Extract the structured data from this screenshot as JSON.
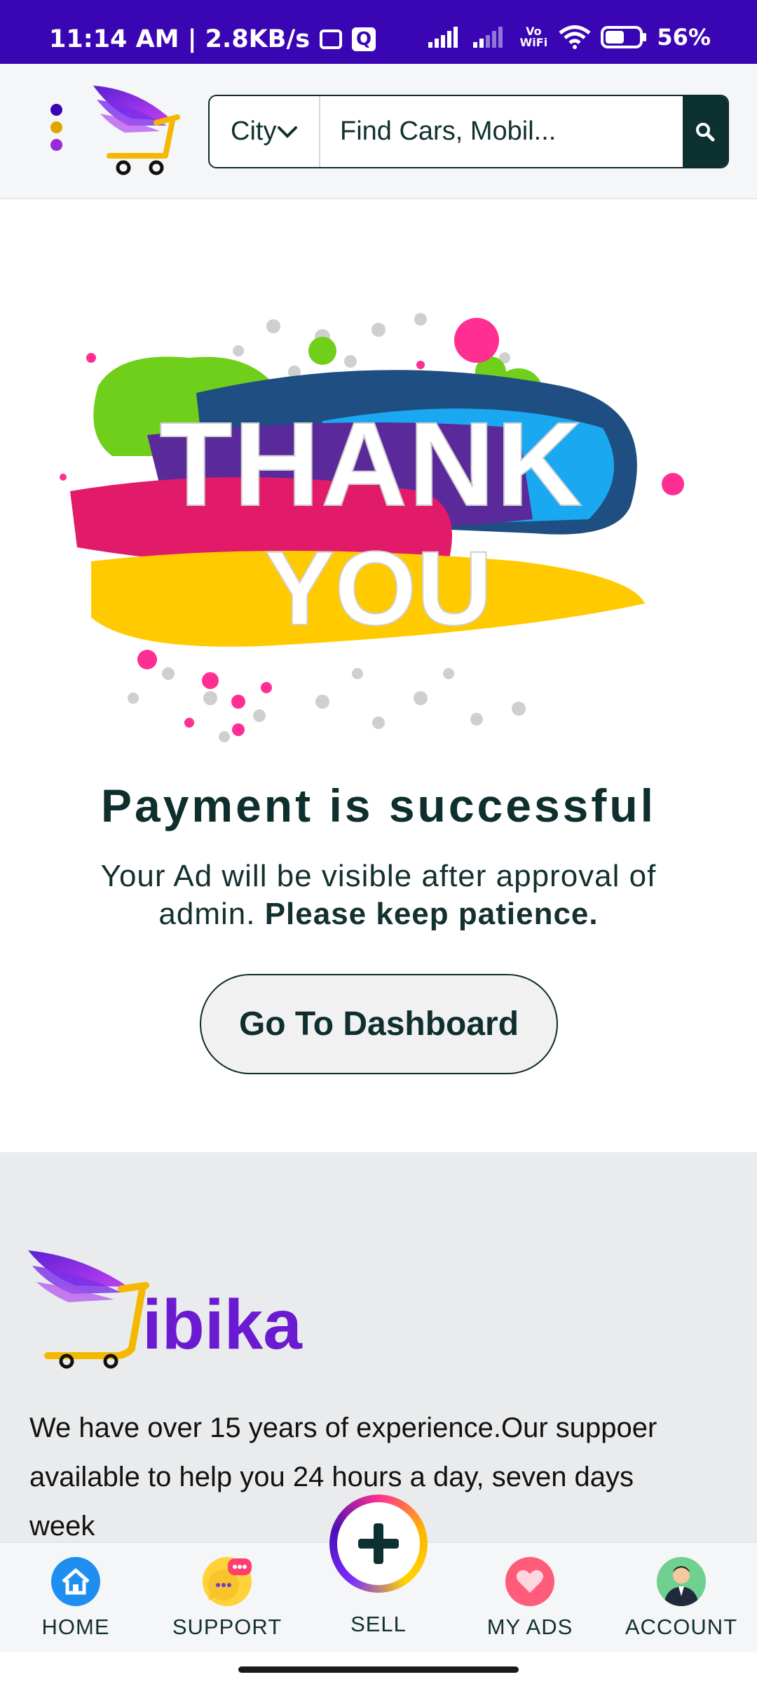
{
  "status_bar": {
    "time": "11:14 AM | 2.8KB/s",
    "vowifi": "Vo WiFi",
    "battery": "56%"
  },
  "header": {
    "city_label": "City",
    "search_placeholder": "Find Cars, Mobil..."
  },
  "banner": {
    "line1": "THANK",
    "line2": "YOU"
  },
  "main": {
    "headline": "Payment is successful",
    "message": "Your Ad will be visible after approval of admin.",
    "message_bold": "Please keep patience.",
    "dashboard_button": "Go To Dashboard"
  },
  "footer": {
    "brand": "ibika",
    "description": "We have over 15 years of experience.Our suppoer available to help you 24 hours a day, seven days week"
  },
  "bottom_nav": {
    "items": [
      {
        "label": "HOME"
      },
      {
        "label": "SUPPORT"
      },
      {
        "label": "SELL"
      },
      {
        "label": "MY ADS"
      },
      {
        "label": "ACCOUNT"
      }
    ]
  },
  "colors": {
    "status_bar": "#3a06b3",
    "primary_dark": "#0d3030",
    "brand_purple": "#6a1bd1",
    "brand_yellow": "#f5b800"
  }
}
